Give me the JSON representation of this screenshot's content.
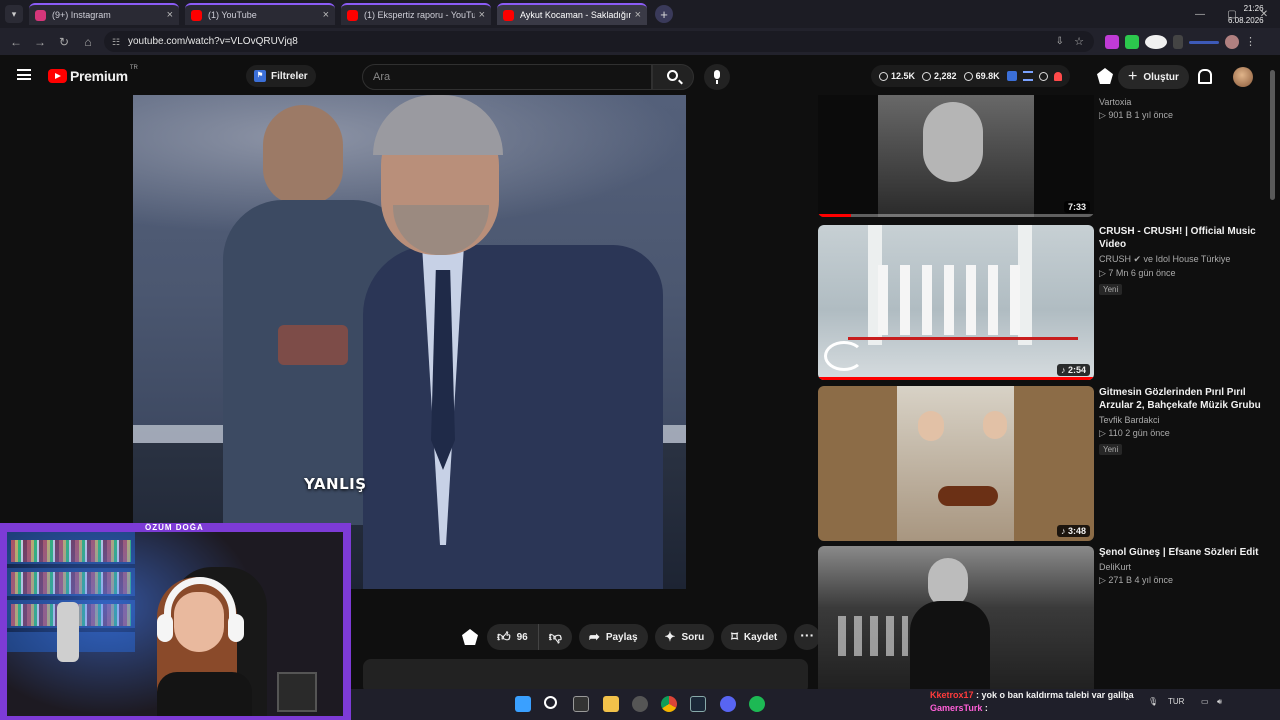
{
  "browser": {
    "tabs": [
      {
        "title": "(9+) Instagram",
        "color": "#d6367a"
      },
      {
        "title": "(1) YouTube",
        "color": "#ff0000"
      },
      {
        "title": "(1) Ekspertiz raporu - YouTube",
        "color": "#ff0000"
      },
      {
        "title": "Aykut Kocaman - Sakladığın Ba",
        "color": "#ff0000"
      }
    ],
    "new_tab": "+",
    "url": "youtube.com/watch?v=VLOvQRUVjq8"
  },
  "youtube": {
    "logo": "Premium",
    "region": "TR",
    "filters_label": "Filtreler",
    "search_placeholder": "Ara",
    "stats": {
      "a": "12.5K",
      "b": "2,282",
      "c": "69.8K"
    },
    "create_label": "Oluştur"
  },
  "video": {
    "caption": "YANLIŞ",
    "likes": "96",
    "share_label": "Paylaş",
    "ask_label": "Soru",
    "save_label": "Kaydet"
  },
  "recommendations": [
    {
      "title": "",
      "channel": "Vartoxia",
      "info": "▷ 901 B   1 yıl önce",
      "duration": "7:33",
      "badge": "",
      "progress": 0.12,
      "colors": [
        "#151515",
        "#9a9a9a"
      ]
    },
    {
      "title": "CRUSH - CRUSH! | Official Music Video",
      "channel": "CRUSH ✔ ve Idol House Türkiye",
      "info": "▷ 7 Mn   6 gün önce",
      "duration": "2:54",
      "badge": "Yeni",
      "progress": 1.0,
      "colors": [
        "#b9c6cc",
        "#e9ecef"
      ]
    },
    {
      "title": "Gitmesin Gözlerinden Pırıl Pırıl Arzular 2, Bahçekafe Müzik Grubu",
      "channel": "Tevfik Bardakci",
      "info": "▷ 110   2 gün önce",
      "duration": "3:48",
      "badge": "Yeni",
      "progress": 0,
      "colors": [
        "#8a6a45",
        "#cfc8bb"
      ]
    },
    {
      "title": "Şenol Güneş | Efsane Sözleri Edit",
      "channel": "DeliKurt",
      "info": "▷ 271 B   4 yıl önce",
      "duration": "",
      "badge": "",
      "progress": 0,
      "colors": [
        "#2a2a2a",
        "#8d8d8d"
      ]
    }
  ],
  "stream": {
    "name": "ÖZÜM DOĞA",
    "chat": [
      {
        "user": "Kketrox17",
        "msg": ": yok o ban kaldırma talebi var galiba",
        "color": "#ff3b3b"
      },
      {
        "user": "GamersTurk",
        "msg": ":",
        "color": "#ff5fd7"
      }
    ]
  },
  "system": {
    "lang": "TUR",
    "time": "21:26",
    "date": "6.08.2026"
  }
}
